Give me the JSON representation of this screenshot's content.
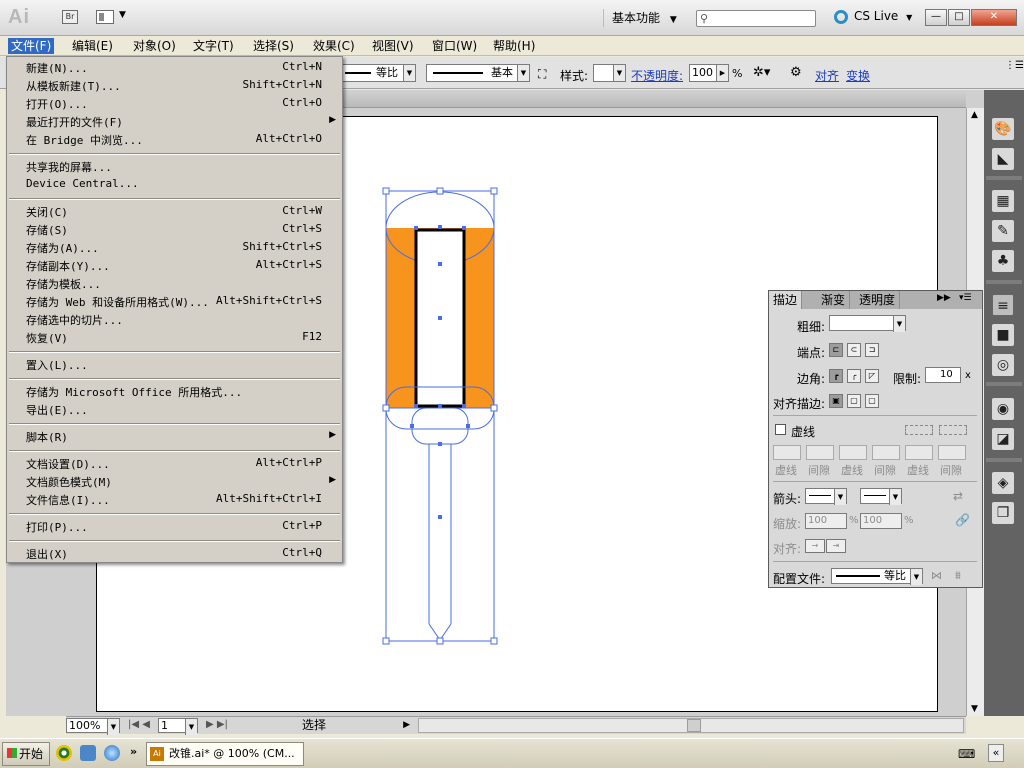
{
  "app": {
    "logo": "Ai",
    "bridge": "Br",
    "workspace": "基本功能",
    "search_placeholder": "",
    "cslive": "CS Live",
    "win_min": "—",
    "win_max": "□",
    "win_close": "✕"
  },
  "menubar": [
    {
      "label": "文件(F)",
      "name": "menu-file"
    },
    {
      "label": "编辑(E)",
      "name": "menu-edit"
    },
    {
      "label": "对象(O)",
      "name": "menu-object"
    },
    {
      "label": "文字(T)",
      "name": "menu-type"
    },
    {
      "label": "选择(S)",
      "name": "menu-select"
    },
    {
      "label": "效果(C)",
      "name": "menu-effect"
    },
    {
      "label": "视图(V)",
      "name": "menu-view"
    },
    {
      "label": "窗口(W)",
      "name": "menu-window"
    },
    {
      "label": "帮助(H)",
      "name": "menu-help"
    }
  ],
  "controlbar": {
    "profile_value": "等比",
    "brush_value": "基本",
    "style_label": "样式:",
    "opacity_label": "不透明度:",
    "opacity_value": "100",
    "opacity_unit": "%",
    "align_link": "对齐",
    "transform_link": "变换"
  },
  "file_menu": {
    "items": [
      {
        "label": "新建(N)...",
        "shortcut": "Ctrl+N"
      },
      {
        "label": "从模板新建(T)...",
        "shortcut": "Shift+Ctrl+N"
      },
      {
        "label": "打开(O)...",
        "shortcut": "Ctrl+O"
      },
      {
        "label": "最近打开的文件(F)",
        "shortcut": "",
        "submenu": true
      },
      {
        "label": "在 Bridge 中浏览...",
        "shortcut": "Alt+Ctrl+O"
      },
      {
        "sep": true
      },
      {
        "label": "共享我的屏幕...",
        "shortcut": ""
      },
      {
        "label": "Device Central...",
        "shortcut": ""
      },
      {
        "sep": true
      },
      {
        "label": "关闭(C)",
        "shortcut": "Ctrl+W"
      },
      {
        "label": "存储(S)",
        "shortcut": "Ctrl+S"
      },
      {
        "label": "存储为(A)...",
        "shortcut": "Shift+Ctrl+S"
      },
      {
        "label": "存储副本(Y)...",
        "shortcut": "Alt+Ctrl+S"
      },
      {
        "label": "存储为模板...",
        "shortcut": ""
      },
      {
        "label": "存储为 Web 和设备所用格式(W)...",
        "shortcut": "Alt+Shift+Ctrl+S"
      },
      {
        "label": "存储选中的切片...",
        "shortcut": ""
      },
      {
        "label": "恢复(V)",
        "shortcut": "F12"
      },
      {
        "sep": true
      },
      {
        "label": "置入(L)...",
        "shortcut": ""
      },
      {
        "sep": true
      },
      {
        "label": "存储为 Microsoft Office 所用格式...",
        "shortcut": ""
      },
      {
        "label": "导出(E)...",
        "shortcut": ""
      },
      {
        "sep": true
      },
      {
        "label": "脚本(R)",
        "shortcut": "",
        "submenu": true
      },
      {
        "sep": true
      },
      {
        "label": "文档设置(D)...",
        "shortcut": "Alt+Ctrl+P"
      },
      {
        "label": "文档颜色模式(M)",
        "shortcut": "",
        "submenu": true
      },
      {
        "label": "文件信息(I)...",
        "shortcut": "Alt+Shift+Ctrl+I"
      },
      {
        "sep": true
      },
      {
        "label": "打印(P)...",
        "shortcut": "Ctrl+P"
      },
      {
        "sep": true
      },
      {
        "label": "退出(X)",
        "shortcut": "Ctrl+Q"
      }
    ]
  },
  "stroke_panel": {
    "tabs": [
      "描边",
      "渐变",
      "透明度"
    ],
    "weight_label": "粗细:",
    "cap_label": "端点:",
    "corner_label": "边角:",
    "limit_label": "限制:",
    "limit_value": "10",
    "limit_unit": "x",
    "align_label": "对齐描边:",
    "dashed_label": "虚线",
    "dash_labels": [
      "虚线",
      "间隙",
      "虚线",
      "间隙",
      "虚线",
      "间隙"
    ],
    "arrow_label": "箭头:",
    "scale_label": "缩放:",
    "scale_value_1": "100",
    "scale_value_2": "100",
    "scale_unit": "%",
    "align_arrow_label": "对齐:",
    "profile_label": "配置文件:",
    "profile_value": "等比"
  },
  "statusbar": {
    "zoom": "100%",
    "page": "1",
    "selection": "选择"
  },
  "taskbar": {
    "start": "开始",
    "task_label": "改锥.ai* @ 100% (CM...",
    "task_icon": "Ai"
  },
  "colors": {
    "orange_fill": "#f7941d",
    "selection_blue": "#4a6de5",
    "menu_highlight": "#316ac5"
  }
}
